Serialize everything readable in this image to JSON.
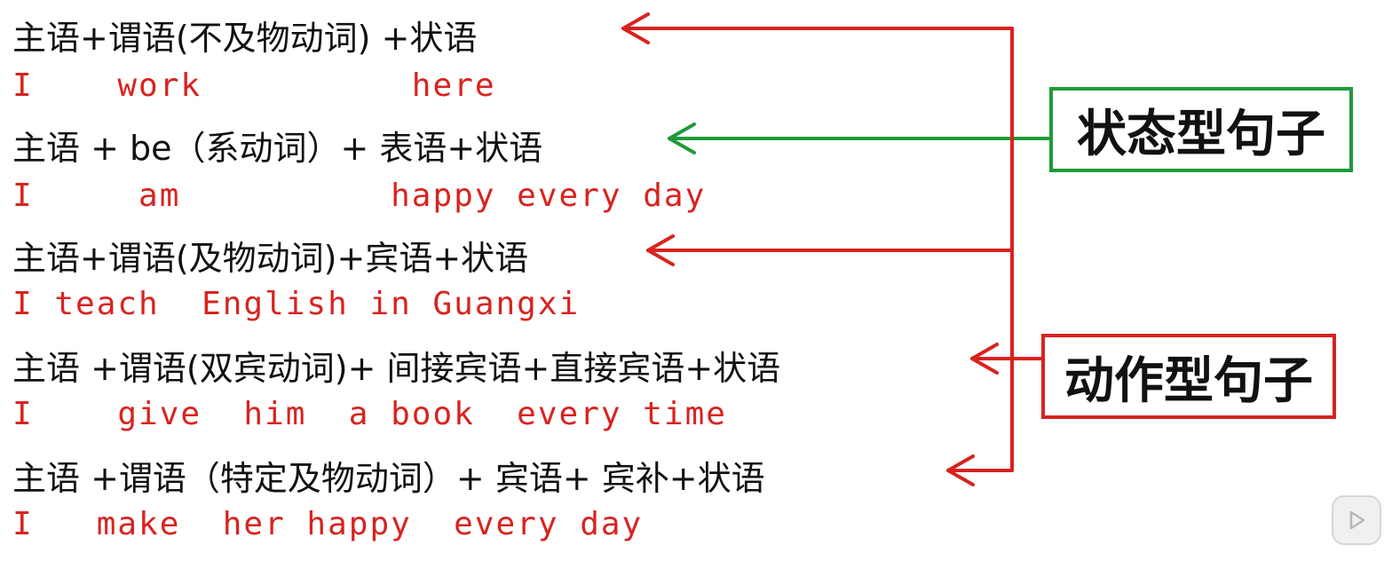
{
  "rows": [
    {
      "pattern": "主语+谓语(不及物动词) +状语",
      "example": "I    work          here"
    },
    {
      "pattern": "主语 + be（系动词）+ 表语+状语",
      "example": "I     am          happy every day"
    },
    {
      "pattern": "主语+谓语(及物动词)+宾语+状语",
      "example": "I teach  English in Guangxi"
    },
    {
      "pattern": "主语 +谓语(双宾动词)+ 间接宾语+直接宾语+状语",
      "example": "I    give  him  a book  every time"
    },
    {
      "pattern": "主语 +谓语（特定及物动词）+ 宾语+ 宾补+状语",
      "example": "I   make  her happy  every day"
    }
  ],
  "labels": {
    "state": "状态型句子",
    "action": "动作型句子"
  },
  "colors": {
    "pattern_text": "#111111",
    "example_text": "#d8231f",
    "state_accent": "#1f9a3a",
    "action_accent": "#d8231f"
  },
  "icons": {
    "player": "play-icon"
  }
}
